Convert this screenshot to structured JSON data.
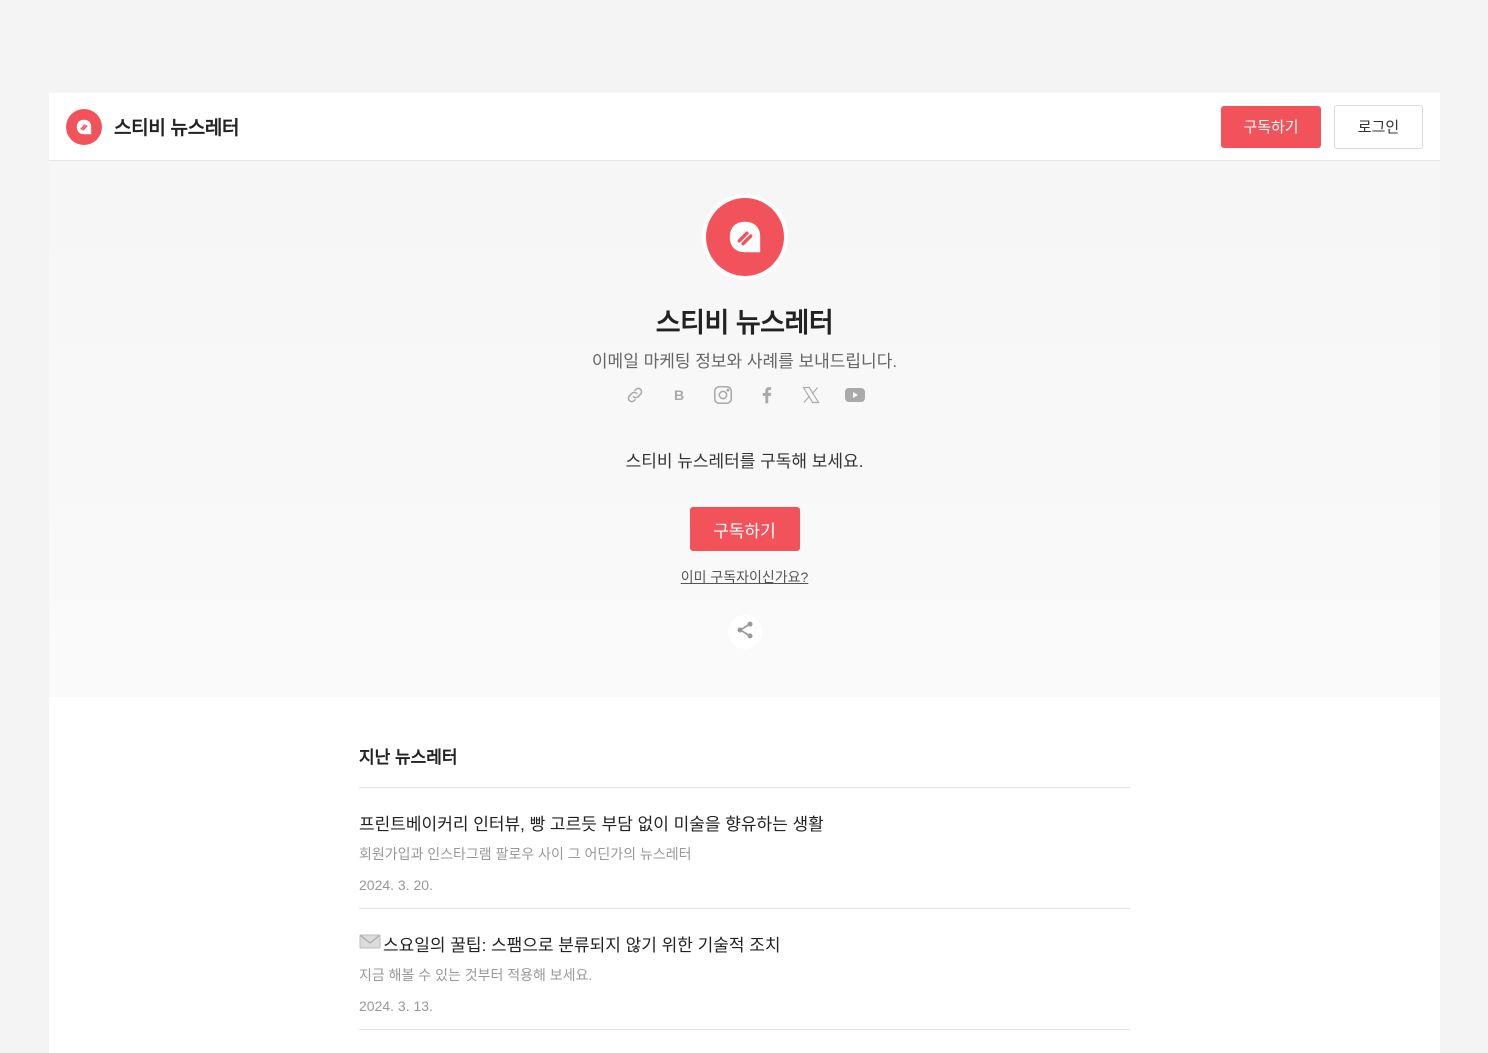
{
  "header": {
    "brand_name": "스티비 뉴스레터",
    "subscribe_label": "구독하기",
    "login_label": "로그인"
  },
  "hero": {
    "title": "스티비 뉴스레터",
    "description": "이메일 마케팅 정보와 사례를 보내드립니다.",
    "social_icons": [
      "link-icon",
      "blog-icon",
      "instagram-icon",
      "facebook-icon",
      "x-icon",
      "youtube-icon"
    ],
    "cta_text": "스티비 뉴스레터를 구독해 보세요.",
    "subscribe_label": "구독하기",
    "already_subscribed_label": "이미 구독자이신가요?"
  },
  "archive": {
    "title": "지난 뉴스레터",
    "items": [
      {
        "title": "프린트베이커리 인터뷰, 빵 고르듯 부담 없이 미술을 향유하는 생활",
        "subtitle": "회원가입과 인스타그램 팔로우 사이 그 어딘가의 뉴스레터",
        "date": "2024. 3. 20."
      },
      {
        "title": "스요일의 꿀팁: 스팸으로 분류되지 않기 위한 기술적 조치",
        "subtitle": "지금 해볼 수 있는 것부터 적용해 보세요.",
        "date": "2024. 3. 13."
      }
    ]
  },
  "colors": {
    "accent": "#f2535b",
    "background": "#f4f4f4"
  }
}
